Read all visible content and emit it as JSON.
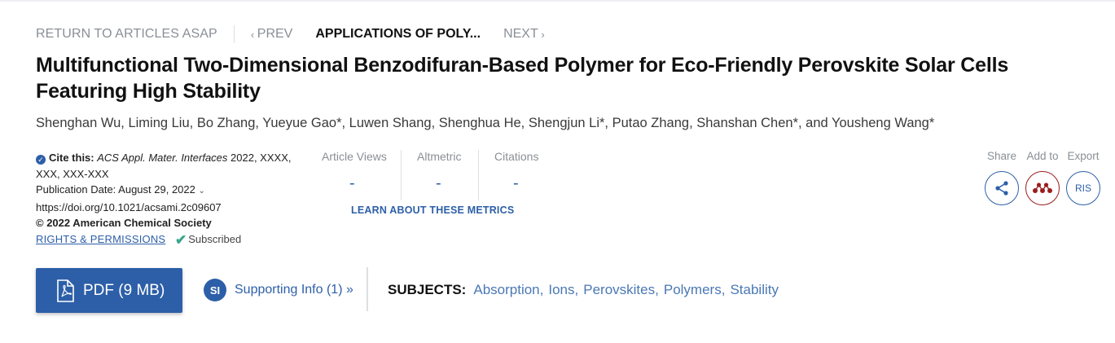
{
  "nav": {
    "return_label": "RETURN TO ARTICLES ASAP",
    "prev_label": "PREV",
    "current_label": "APPLICATIONS OF POLY...",
    "next_label": "NEXT"
  },
  "article": {
    "title": "Multifunctional Two-Dimensional Benzodifuran-Based Polymer for Eco-Friendly Perovskite Solar Cells Featuring High Stability",
    "authors": "Shenghan Wu, Liming Liu, Bo Zhang, Yueyue Gao*, Luwen Shang, Shenghua He, Shengjun Li*, Putao Zhang, Shanshan Chen*, and Yousheng Wang*"
  },
  "citation": {
    "cite_label": "Cite this:",
    "journal": "ACS Appl. Mater. Interfaces",
    "details": " 2022, XXXX, XXX, XXX-XXX",
    "pub_date": "Publication Date: August 29, 2022",
    "doi": "https://doi.org/10.1021/acsami.2c09607",
    "copyright": "© 2022 American Chemical Society",
    "rights_label": "RIGHTS & PERMISSIONS",
    "subscribed_label": "Subscribed"
  },
  "metrics": {
    "views_label": "Article Views",
    "views_value": "-",
    "altmetric_label": "Altmetric",
    "altmetric_value": "-",
    "citations_label": "Citations",
    "citations_value": "-",
    "learn_label": "LEARN ABOUT THESE METRICS"
  },
  "actions": {
    "share_label": "Share",
    "add_label": "Add to",
    "export_label": "Export",
    "ris_label": "RIS"
  },
  "bottom": {
    "pdf_label": "PDF (9 MB)",
    "si_badge": "SI",
    "si_label": "Supporting Info (1) »",
    "subjects_label": "SUBJECTS:",
    "subjects": [
      "Absorption",
      "Ions",
      "Perovskites",
      "Polymers",
      "Stability"
    ]
  },
  "colors": {
    "accent": "#2d5fa8",
    "mendeley": "#9b1d1d",
    "muted": "#8a8f96",
    "check": "#3aa58a"
  },
  "icons": [
    "chevron-left-icon",
    "chevron-right-icon",
    "chevron-down-icon",
    "check-circle-icon",
    "checkmark-icon",
    "share-icon",
    "mendeley-icon",
    "pdf-file-icon"
  ]
}
